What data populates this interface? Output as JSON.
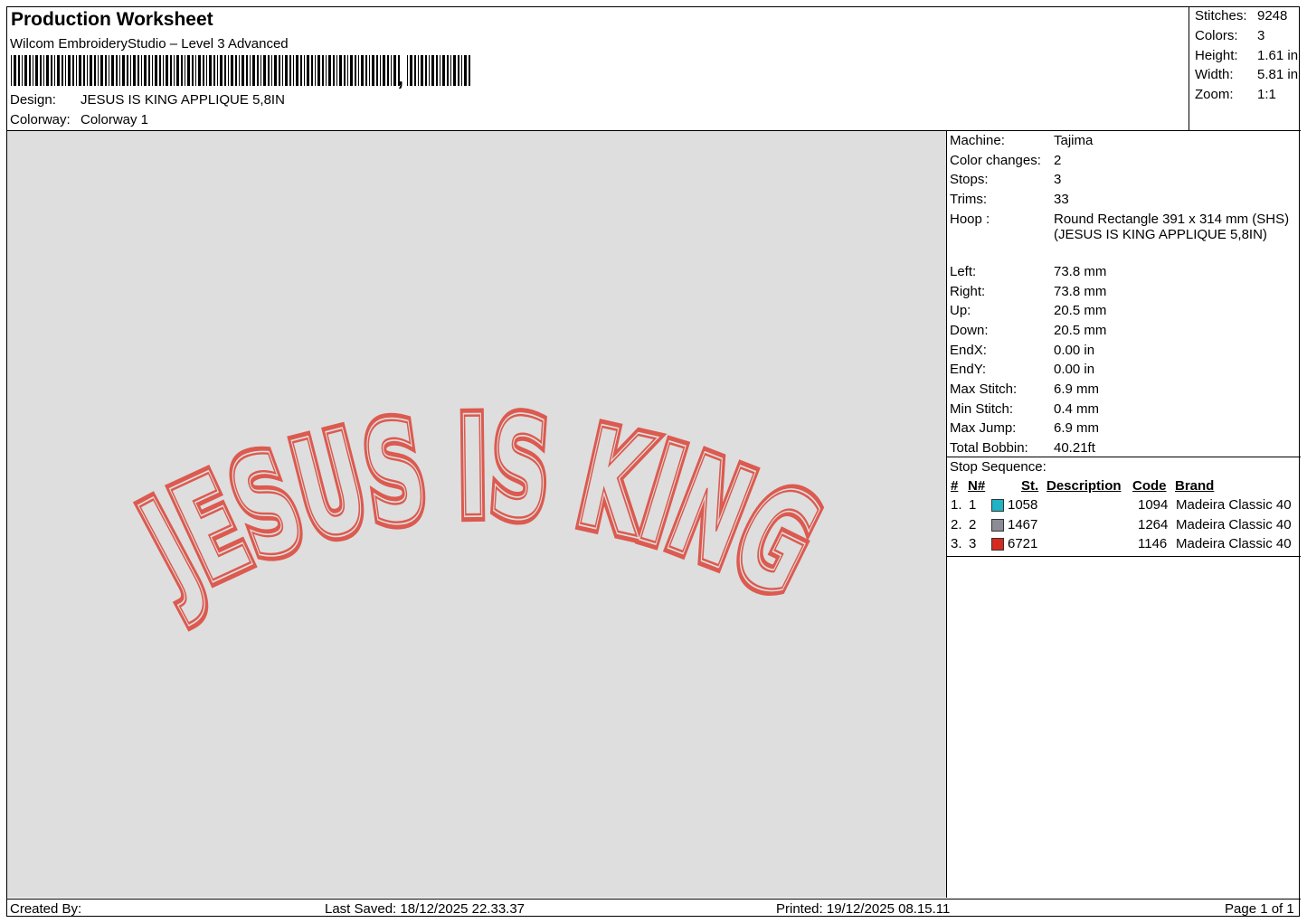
{
  "header": {
    "title": "Production Worksheet",
    "software": "Wilcom EmbroideryStudio – Level 3 Advanced",
    "design_label": "Design:",
    "design_value": "JESUS IS KING APPLIQUE 5,8IN",
    "colorway_label": "Colorway:",
    "colorway_value": "Colorway 1"
  },
  "stats": [
    {
      "label": "Stitches:",
      "value": "9248"
    },
    {
      "label": "Colors:",
      "value": "3"
    },
    {
      "label": "Height:",
      "value": "1.61 in"
    },
    {
      "label": "Width:",
      "value": "5.81 in"
    },
    {
      "label": "Zoom:",
      "value": "1:1"
    }
  ],
  "machine_info": [
    {
      "label": "Machine:",
      "value": "Tajima"
    },
    {
      "label": "Color changes:",
      "value": "2"
    },
    {
      "label": "Stops:",
      "value": "3"
    },
    {
      "label": "Trims:",
      "value": "33"
    },
    {
      "label": "Hoop :",
      "value": "Round Rectangle 391 x 314 mm (SHS) (JESUS IS KING APPLIQUE 5,8IN)"
    },
    {
      "label": "Left:",
      "value": "73.8 mm"
    },
    {
      "label": "Right:",
      "value": "73.8 mm"
    },
    {
      "label": "Up:",
      "value": "20.5 mm"
    },
    {
      "label": "Down:",
      "value": "20.5 mm"
    },
    {
      "label": "EndX:",
      "value": "0.00 in"
    },
    {
      "label": "EndY:",
      "value": "0.00 in"
    },
    {
      "label": "Max Stitch:",
      "value": "6.9 mm"
    },
    {
      "label": "Min Stitch:",
      "value": "0.4 mm"
    },
    {
      "label": "Max Jump:",
      "value": "6.9 mm"
    },
    {
      "label": "Total Bobbin:",
      "value": "40.21ft"
    }
  ],
  "stop_sequence": {
    "title": "Stop Sequence:",
    "headers": {
      "hash": "#",
      "n": "N#",
      "st": "St.",
      "description": "Description",
      "code": "Code",
      "brand": "Brand"
    },
    "rows": [
      {
        "index": "1.",
        "n": "1",
        "color": "#1fb3c4",
        "stitches": "1058",
        "code": "1094",
        "brand": "Madeira Classic 40"
      },
      {
        "index": "2.",
        "n": "2",
        "color": "#8c8c96",
        "stitches": "1467",
        "code": "1264",
        "brand": "Madeira Classic 40"
      },
      {
        "index": "3.",
        "n": "3",
        "color": "#d42a22",
        "stitches": "6721",
        "code": "1146",
        "brand": "Madeira Classic 40"
      }
    ]
  },
  "design_preview": {
    "text": "JESUS IS KING",
    "stroke_color": "#dc5a4f",
    "background_color": "#dedede"
  },
  "footer": {
    "created_by": "Created By:",
    "last_saved": "Last Saved: 18/12/2025 22.33.37",
    "printed": "Printed: 19/12/2025 08.15.11",
    "page": "Page 1 of 1"
  }
}
